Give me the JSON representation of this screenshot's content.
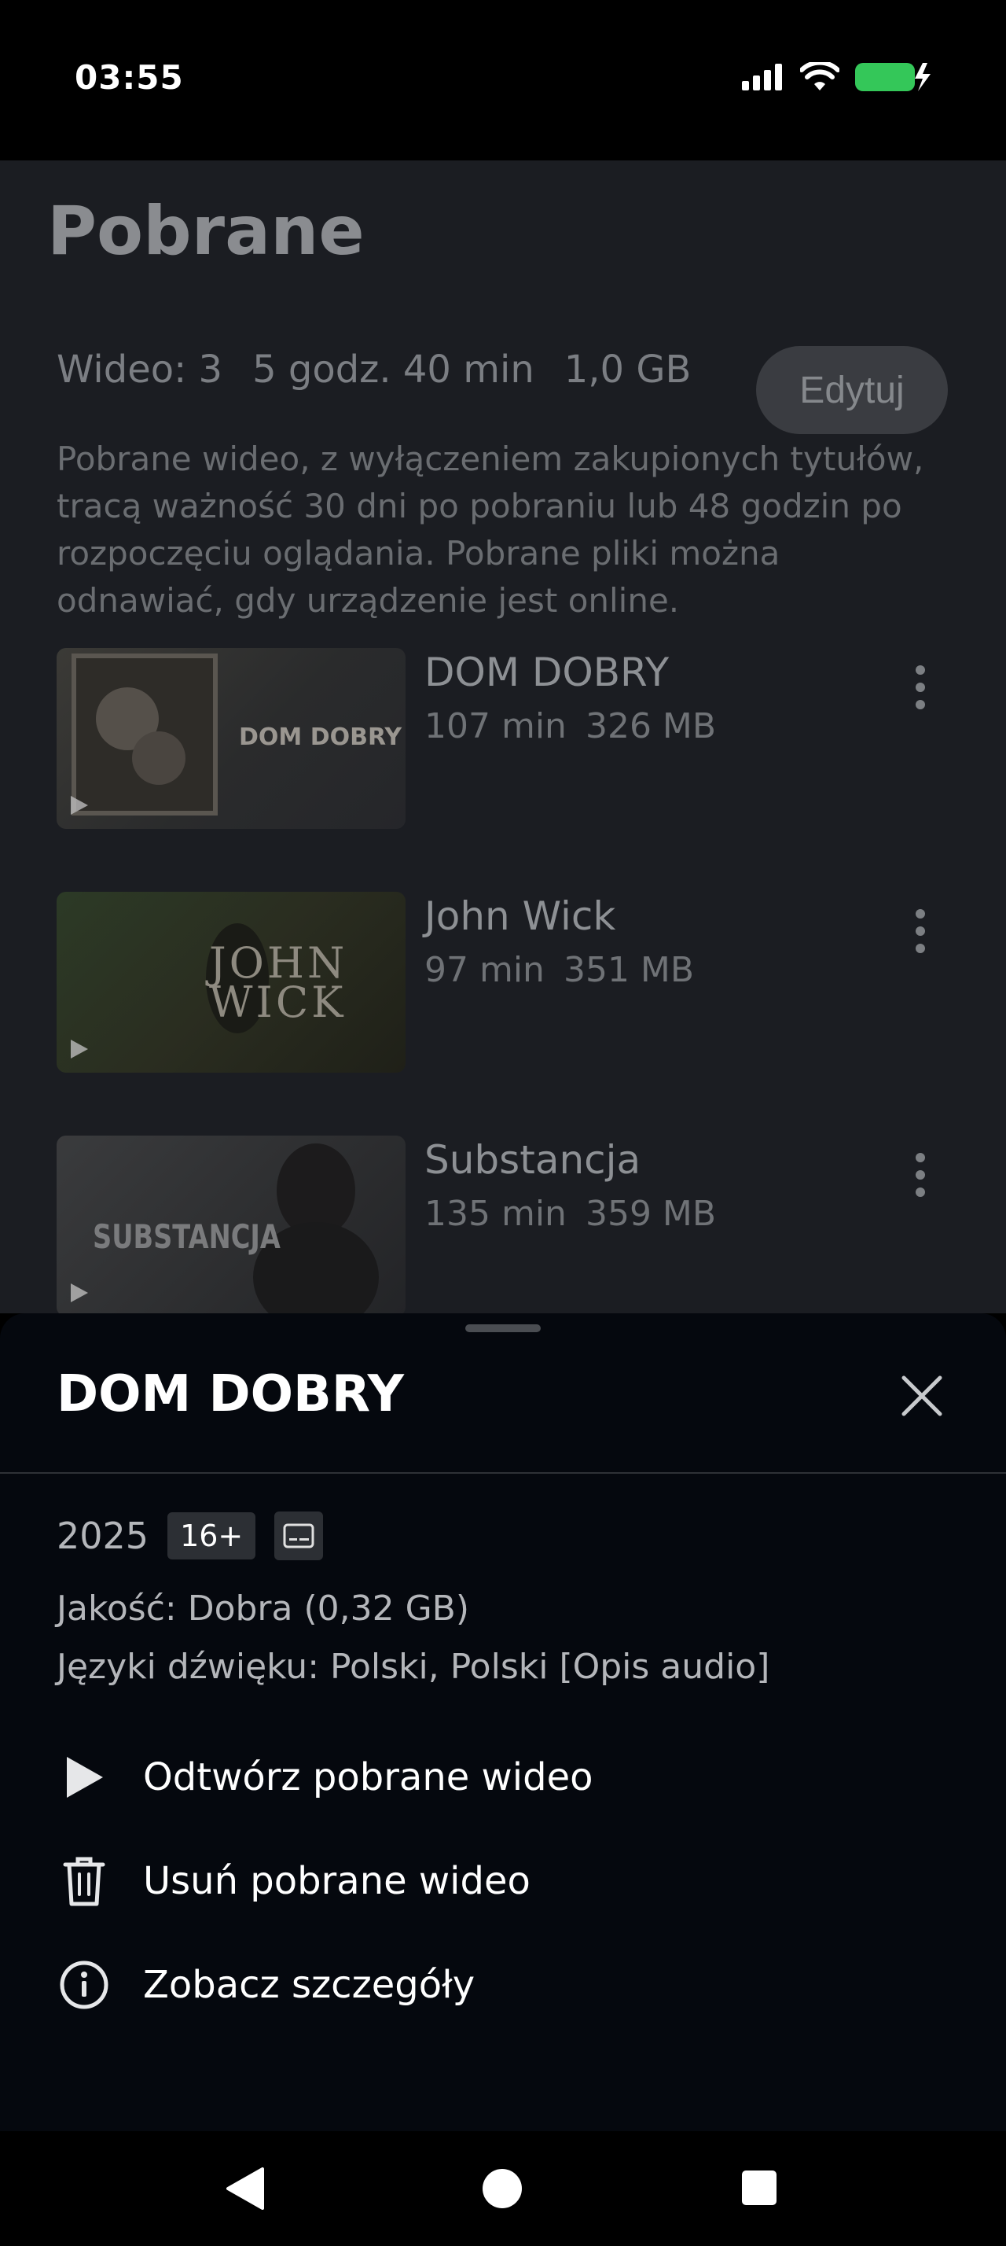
{
  "status_bar": {
    "time": "03:55",
    "icons": [
      "signal-icon",
      "wifi-icon",
      "battery-charging-icon"
    ],
    "battery_color": "#34c759"
  },
  "page": {
    "title": "Pobrane",
    "summary": {
      "videos": "Wideo: 3",
      "duration": "5 godz. 40 min",
      "size": "1,0 GB"
    },
    "edit_label": "Edytuj",
    "info": "Pobrane wideo, z wyłączeniem zakupionych tytułów, tracą ważność 30 dni po pobraniu lub 48 godzin po rozpoczęciu oglądania. Pobrane pliki można odnawiać, gdy urządzenie jest online.",
    "items": [
      {
        "title": "DOM DOBRY",
        "duration": "107 min",
        "size": "326 MB",
        "thumb_caption": "DOM DOBRY"
      },
      {
        "title": "John Wick",
        "duration": "97 min",
        "size": "351 MB",
        "thumb_caption": "JOHN WICK"
      },
      {
        "title": "Substancja",
        "duration": "135 min",
        "size": "359 MB",
        "thumb_caption": "SUBSTANCJA"
      }
    ]
  },
  "sheet": {
    "title": "DOM DOBRY",
    "year": "2025",
    "rating": "16+",
    "quality": "Jakość: Dobra (0,32 GB)",
    "audio": "Języki dźwięku: Polski, Polski [Opis audio]",
    "actions": [
      {
        "label": "Odtwórz pobrane wideo",
        "icon": "play-icon"
      },
      {
        "label": "Usuń pobrane wideo",
        "icon": "trash-icon"
      },
      {
        "label": "Zobacz szczegóły",
        "icon": "info-icon"
      }
    ]
  },
  "nav": {
    "icons": [
      "back-icon",
      "home-icon",
      "recents-icon"
    ]
  }
}
